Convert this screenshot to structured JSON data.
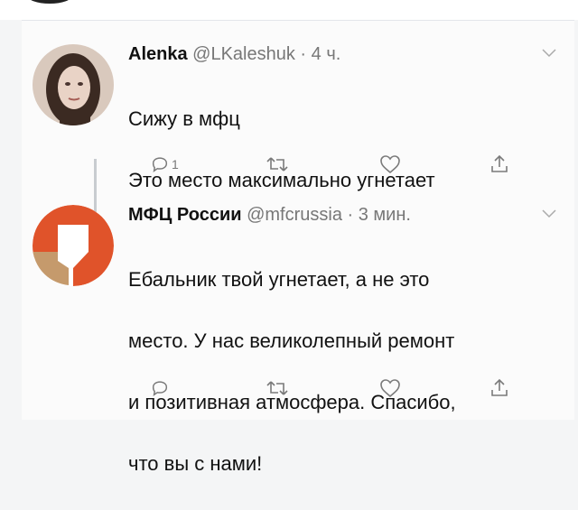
{
  "tweets": [
    {
      "name": "Alenka",
      "handle": "@LKaleshuk",
      "time": "· 4 ч.",
      "lines": [
        "Сижу в мфц",
        "Это место максимально угнетает"
      ],
      "reply_count": "1",
      "avatar_kind": "photo"
    },
    {
      "name": "МФЦ России",
      "handle": "@mfcrussia",
      "time": "· 3 мин.",
      "lines": [
        "Ебальник твой угнетает, а не это",
        "место. У нас великолепный ремонт",
        "и позитивная атмосфера. Спасибо,",
        "что вы с нами!"
      ],
      "reply_count": "",
      "avatar_kind": "logo"
    }
  ],
  "colors": {
    "logo_orange": "#e0532a",
    "logo_tan": "#c59a6c",
    "icon_gray": "#7a7a7a"
  },
  "icons": [
    "reply-icon",
    "retweet-icon",
    "like-icon",
    "share-icon",
    "chevron-down-icon"
  ]
}
